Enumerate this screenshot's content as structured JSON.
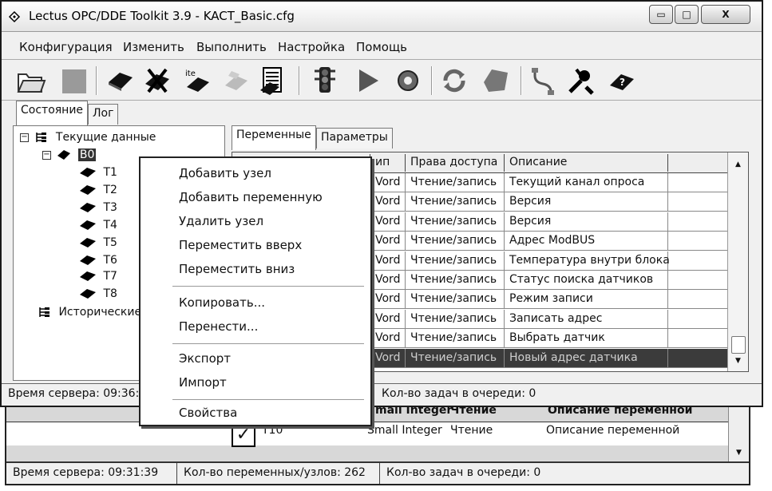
{
  "window": {
    "title": "Lectus OPC/DDE Toolkit 3.9 - KACT_Basic.cfg",
    "minimize_glyph": "▭",
    "maximize_glyph": "□",
    "close_glyph": "X"
  },
  "menu": [
    "Конфигурация",
    "Изменить",
    "Выполнить",
    "Настройка",
    "Помощь"
  ],
  "toolbar_icons": [
    "open-folder-icon",
    "save-icon",
    "add-tag-icon",
    "delete-tag-icon",
    "rename-tag-icon",
    "paste-tag-icon",
    "document-icon",
    "traffic-light-icon",
    "play-icon",
    "record-icon",
    "refresh-icon",
    "stop-icon",
    "connect-icon",
    "tools-icon",
    "help-book-icon"
  ],
  "left_tabs": {
    "state": "Состояние",
    "log": "Лог"
  },
  "tree": {
    "root": "Текущие данные",
    "device": "B0",
    "tags": [
      "T1",
      "T2",
      "T3",
      "T4",
      "T5",
      "T6",
      "T7",
      "T8"
    ],
    "historical": "Исторические"
  },
  "right_tabs": {
    "variables": "Переменные",
    "parameters": "Параметры"
  },
  "grid": {
    "columns": [
      "Тип",
      "Права доступа",
      "Описание"
    ],
    "type_header_visible": "ип",
    "rows": [
      {
        "type": "Vord",
        "access": "Чтение/запись",
        "desc": "Текущий канал опроса"
      },
      {
        "type": "Vord",
        "access": "Чтение/запись",
        "desc": "Версия"
      },
      {
        "type": "Vord",
        "access": "Чтение/запись",
        "desc": "Версия"
      },
      {
        "type": "Vord",
        "access": "Чтение/запись",
        "desc": "Адрес ModBUS"
      },
      {
        "type": "Vord",
        "access": "Чтение/запись",
        "desc": "Температура внутри блока"
      },
      {
        "type": "Vord",
        "access": "Чтение/запись",
        "desc": "Статус поиска датчиков"
      },
      {
        "type": "Vord",
        "access": "Чтение/запись",
        "desc": "Режим записи"
      },
      {
        "type": "Vord",
        "access": "Чтение/запись",
        "desc": "Записать адрес"
      },
      {
        "type": "Vord",
        "access": "Чтение/запись",
        "desc": "Выбрать датчик"
      },
      {
        "type": "Vord",
        "access": "Чтение/запись",
        "desc": "Новый адрес датчика"
      }
    ]
  },
  "status": {
    "server_time": "Время сервера: 09:36:",
    "tasks": "Кол-во задач в очереди: 0"
  },
  "context_menu": {
    "add_node": "Добавить узел",
    "add_variable": "Добавить переменную",
    "delete_node": "Удалить узел",
    "move_up": "Переместить вверх",
    "move_down": "Переместить вниз",
    "copy": "Копировать...",
    "move": "Перенести...",
    "export": "Экспорт",
    "import": "Импорт",
    "properties": "Свойства"
  },
  "background_window": {
    "partial_header": [
      "mall Integer",
      "Чтение",
      "Описание переменной"
    ],
    "row": {
      "name": "T10",
      "type": "Small Integer",
      "access": "Чтение",
      "desc": "Описание переменной"
    },
    "status": {
      "server_time": "Время сервера: 09:31:39",
      "count": "Кол-во переменных/узлов: 262",
      "tasks": "Кол-во задач в очереди: 0"
    }
  }
}
